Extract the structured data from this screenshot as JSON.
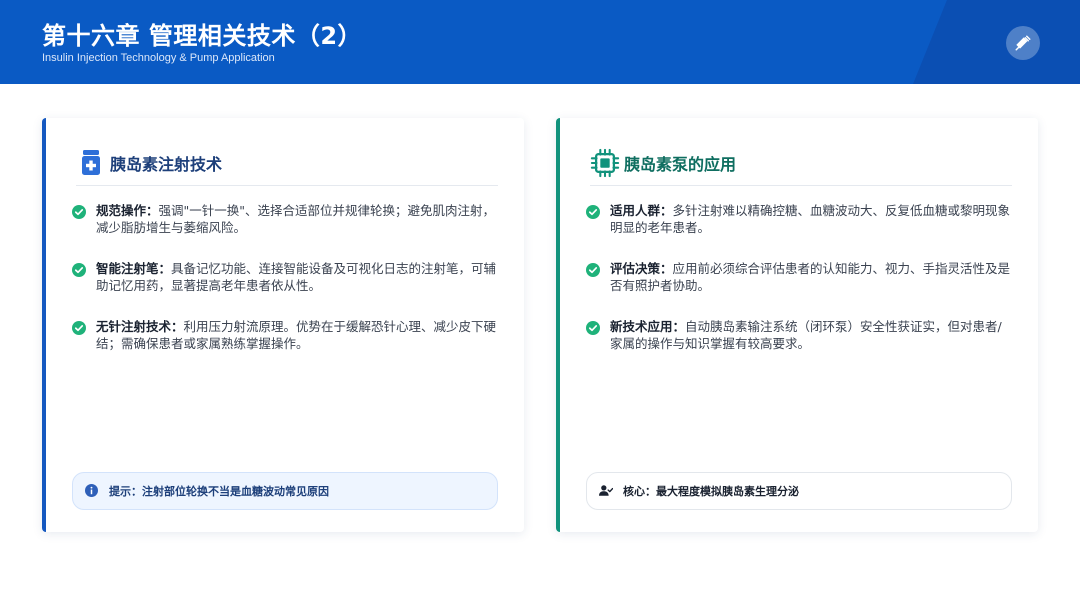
{
  "header": {
    "title": "第十六章 管理相关技术（2）",
    "subtitle": "Insulin Injection Technology & Pump Application",
    "icon": "syringe-icon"
  },
  "left_card": {
    "title": "胰岛素注射技术",
    "icon": "medicine-bottle-icon",
    "accent": "#1558c0",
    "items": [
      {
        "label": "规范操作：",
        "text": "强调\"一针一换\"、选择合适部位并规律轮换；避免肌肉注射，减少脂肪增生与萎缩风险。"
      },
      {
        "label": "智能注射笔：",
        "text": "具备记忆功能、连接智能设备及可视化日志的注射笔，可辅助记忆用药，显著提高老年患者依从性。"
      },
      {
        "label": "无针注射技术：",
        "text": "利用压力射流原理。优势在于缓解恐针心理、减少皮下硬结；需确保患者或家属熟练掌握操作。"
      }
    ],
    "tip": "提示：注射部位轮换不当是血糖波动常见原因"
  },
  "right_card": {
    "title": "胰岛素泵的应用",
    "icon": "microchip-icon",
    "accent": "#11927c",
    "items": [
      {
        "label": "适用人群：",
        "text": "多针注射难以精确控糖、血糖波动大、反复低血糖或黎明现象明显的老年患者。"
      },
      {
        "label": "评估决策：",
        "text": "应用前必须综合评估患者的认知能力、视力、手指灵活性及是否有照护者协助。"
      },
      {
        "label": "新技术应用：",
        "text": "自动胰岛素输注系统（闭环泵）安全性获证实，但对患者/家属的操作与知识掌握有较高要求。"
      }
    ],
    "tip": "核心：最大程度模拟胰岛素生理分泌"
  },
  "colors": {
    "header_bg": "#0a5ac4",
    "check_green": "#1fb27a",
    "left_accent": "#1558c0",
    "right_accent": "#11927c"
  }
}
